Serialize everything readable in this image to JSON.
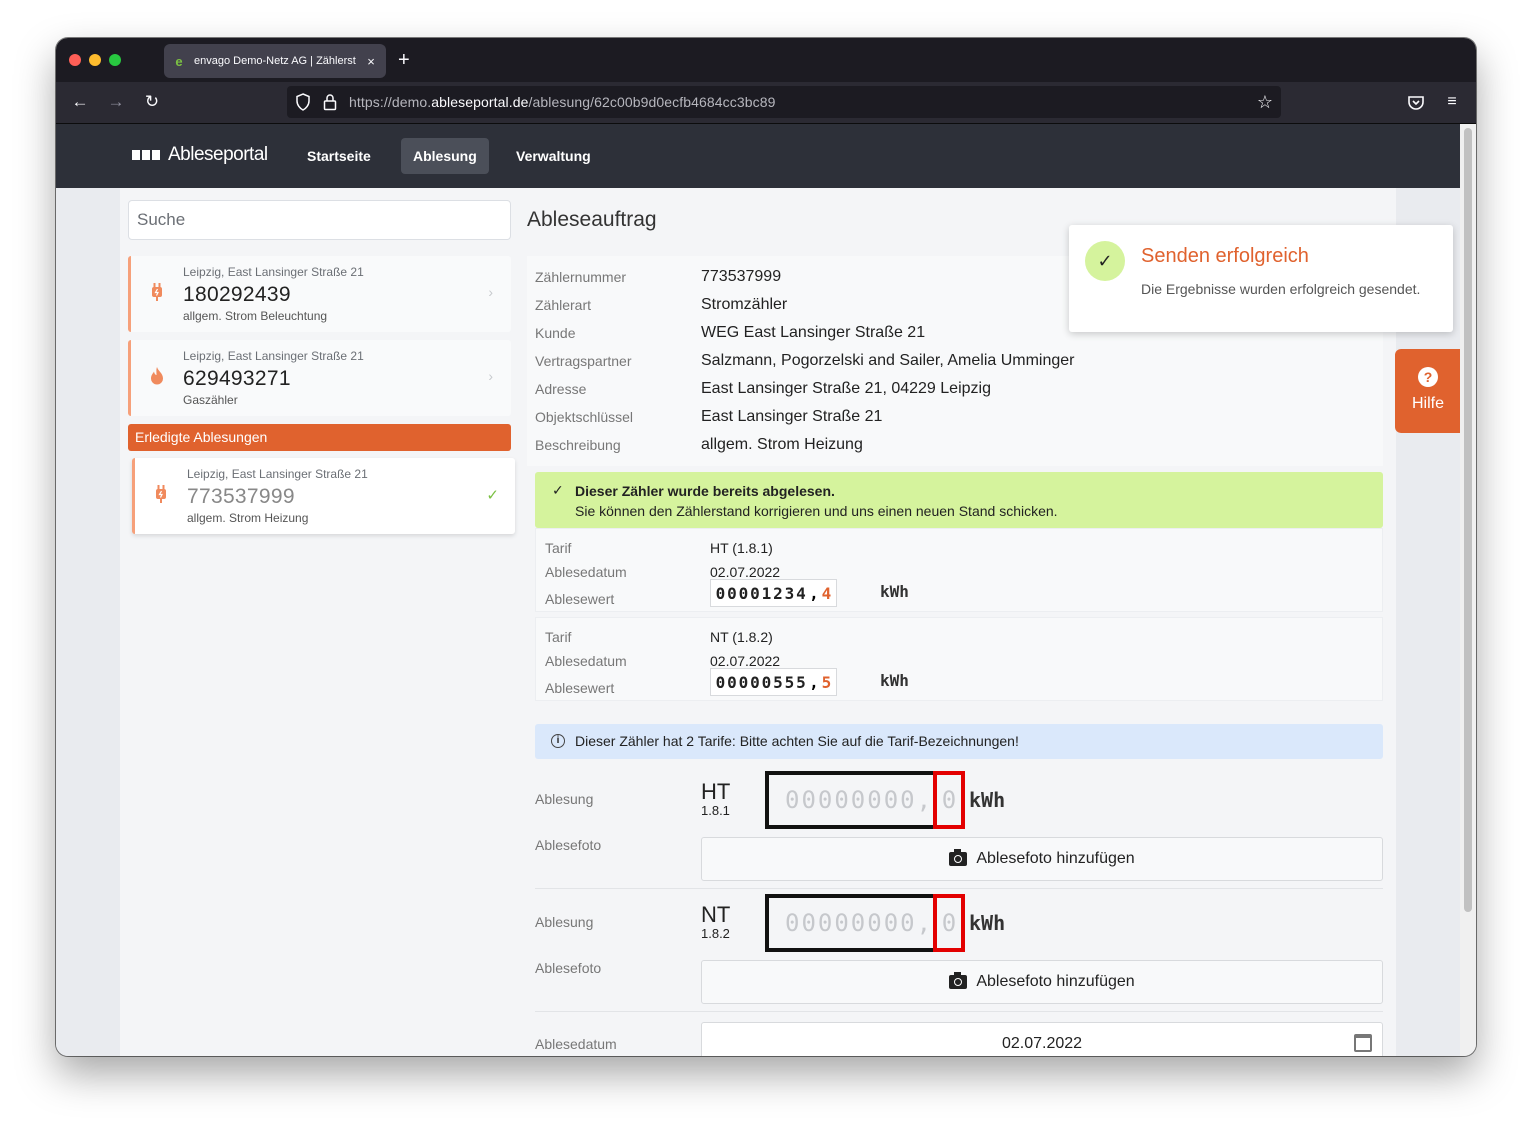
{
  "browser": {
    "tab_title": "envago Demo-Netz AG | Zählerst",
    "tab_close": "×",
    "new_tab": "+",
    "url_prefix": "https://demo.",
    "url_domain": "ableseportal.de",
    "url_path": "/ablesung/62c00b9d0ecfb4684cc3bc89"
  },
  "app": {
    "brand": "Ableseportal",
    "nav": [
      "Startseite",
      "Ablesung",
      "Verwaltung"
    ],
    "active_nav": "Ablesung"
  },
  "sidebar": {
    "search_placeholder": "Suche",
    "open_items": [
      {
        "location": "Leipzig, East Lansinger Straße 21",
        "number": "180292439",
        "description": "allgem. Strom Beleuchtung",
        "icon": "plug-icon"
      },
      {
        "location": "Leipzig, East Lansinger Straße 21",
        "number": "629493271",
        "description": "Gaszähler",
        "icon": "flame-icon"
      }
    ],
    "done_header": "Erledigte Ablesungen",
    "done_items": [
      {
        "location": "Leipzig, East Lansinger Straße 21",
        "number": "773537999",
        "description": "allgem. Strom Heizung",
        "icon": "plug-icon"
      }
    ]
  },
  "main": {
    "title": "Ableseauftrag",
    "details": [
      {
        "key": "Zählernummer",
        "value": "773537999"
      },
      {
        "key": "Zählerart",
        "value": "Stromzähler"
      },
      {
        "key": "Kunde",
        "value": "WEG East Lansinger Straße 21"
      },
      {
        "key": "Vertragspartner",
        "value": "Salzmann, Pogorzelski and Sailer, Amelia Umminger"
      },
      {
        "key": "Adresse",
        "value": "East Lansinger Straße 21, 04229 Leipzig"
      },
      {
        "key": "Objektschlüssel",
        "value": "East Lansinger Straße 21"
      },
      {
        "key": "Beschreibung",
        "value": "allgem. Strom Heizung"
      }
    ],
    "success_title": "Dieser Zähler wurde bereits abgelesen.",
    "success_text": "Sie können den Zählerstand korrigieren und uns einen neuen Stand schicken.",
    "previous": [
      {
        "tarif_label": "Tarif",
        "tarif": "HT (1.8.1)",
        "date_label": "Ablesedatum",
        "date": "02.07.2022",
        "value_label": "Ablesewert",
        "digits": [
          "0",
          "0",
          "0",
          "0",
          "1",
          "2",
          "3",
          "4"
        ],
        "decimal": "4",
        "unit": "kWh"
      },
      {
        "tarif_label": "Tarif",
        "tarif": "NT (1.8.2)",
        "date_label": "Ablesedatum",
        "date": "02.07.2022",
        "value_label": "Ablesewert",
        "digits": [
          "0",
          "0",
          "0",
          "0",
          "0",
          "5",
          "5",
          "5"
        ],
        "decimal": "5",
        "unit": "kWh"
      }
    ],
    "note": "Dieser Zähler hat 2 Tarife: Bitte achten Sie auf die Tarif-Bezeichnungen!",
    "entries": [
      {
        "label": "Ablesung",
        "tarif_name": "HT",
        "tarif_code": "1.8.1",
        "placeholder_int": "00000000,",
        "placeholder_dec": "0",
        "unit": "kWh",
        "photo_label": "Ablesefoto",
        "photo_button": "Ablesefoto hinzufügen"
      },
      {
        "label": "Ablesung",
        "tarif_name": "NT",
        "tarif_code": "1.8.2",
        "placeholder_int": "00000000,",
        "placeholder_dec": "0",
        "unit": "kWh",
        "photo_label": "Ablesefoto",
        "photo_button": "Ablesefoto hinzufügen"
      }
    ],
    "date_label": "Ablesedatum",
    "date_value": "02.07.2022"
  },
  "toast": {
    "title": "Senden erfolgreich",
    "body": "Die Ergebnisse wurden erfolgreich gesendet."
  },
  "help": {
    "label": "Hilfe",
    "icon": "question-icon"
  },
  "colors": {
    "accent": "#e0622e",
    "success_bg": "#d5f39d",
    "info_bg": "#dae8fb",
    "nav_bg": "#2d3039"
  }
}
